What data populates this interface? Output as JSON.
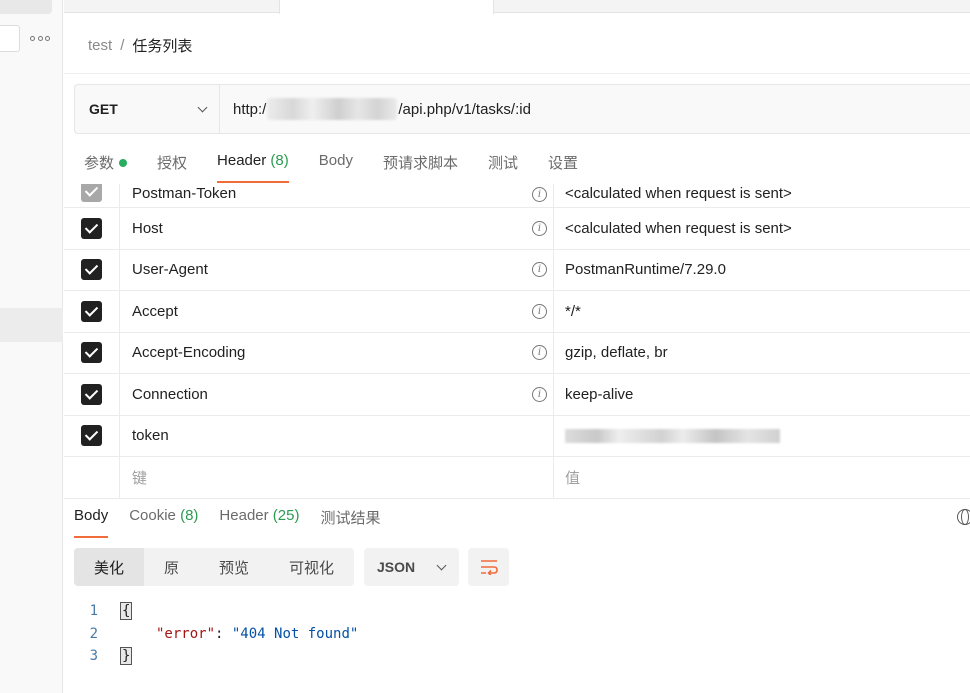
{
  "breadcrumb": {
    "parent": "test",
    "separator": "/",
    "current": "任务列表"
  },
  "request": {
    "method": "GET",
    "url_prefix": "http:/",
    "url_suffix": "/api.php/v1/tasks/:id"
  },
  "request_tabs": [
    {
      "label": "参数",
      "count": "",
      "has_dot": true
    },
    {
      "label": "授权",
      "count": ""
    },
    {
      "label": "Header",
      "count": "(8)",
      "active": true
    },
    {
      "label": "Body",
      "count": ""
    },
    {
      "label": "预请求脚本",
      "count": ""
    },
    {
      "label": "测试",
      "count": ""
    },
    {
      "label": "设置",
      "count": ""
    }
  ],
  "headers": [
    {
      "key": "Postman-Token",
      "value": "<calculated when request is sent>",
      "checked": true,
      "dim": true,
      "info": true
    },
    {
      "key": "Host",
      "value": "<calculated when request is sent>",
      "checked": true,
      "info": true
    },
    {
      "key": "User-Agent",
      "value": "PostmanRuntime/7.29.0",
      "checked": true,
      "info": true
    },
    {
      "key": "Accept",
      "value": "*/*",
      "checked": true,
      "info": true
    },
    {
      "key": "Accept-Encoding",
      "value": "gzip, deflate, br",
      "checked": true,
      "info": true
    },
    {
      "key": "Connection",
      "value": "keep-alive",
      "checked": true,
      "info": true
    },
    {
      "key": "token",
      "value": "",
      "checked": true,
      "info": false,
      "value_redacted": true
    }
  ],
  "new_header": {
    "key_placeholder": "键",
    "value_placeholder": "值"
  },
  "response_tabs": [
    {
      "label": "Body",
      "count": "",
      "active": true
    },
    {
      "label": "Cookie",
      "count": "(8)"
    },
    {
      "label": "Header",
      "count": "(25)"
    },
    {
      "label": "测试结果",
      "count": ""
    }
  ],
  "format_buttons": [
    "美化",
    "原",
    "预览",
    "可视化"
  ],
  "language": "JSON",
  "code_lines": [
    {
      "num": "1",
      "text": "{"
    },
    {
      "num": "2",
      "key": "\"error\"",
      "colon": ": ",
      "value": "\"404 Not found\""
    },
    {
      "num": "3",
      "text": "}"
    }
  ],
  "colors": {
    "accent": "#f26b3a",
    "count_green": "#2c9a52",
    "dot_green": "#27ae60"
  }
}
